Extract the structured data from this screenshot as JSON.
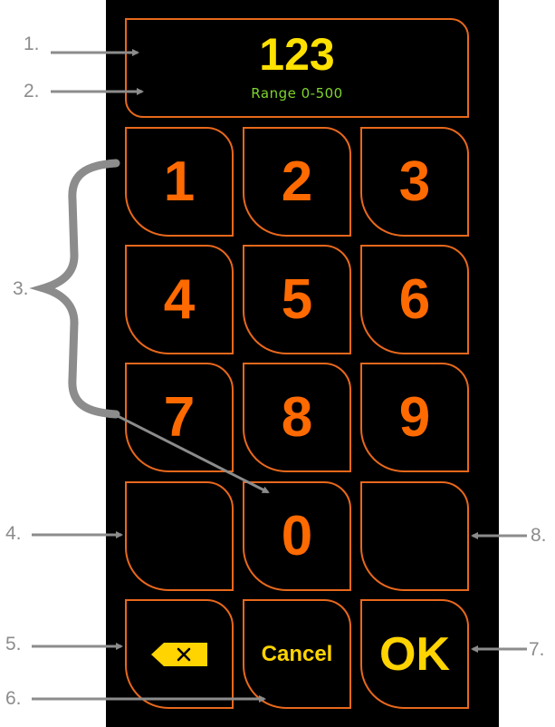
{
  "display": {
    "value": "123",
    "range": "Range 0-500"
  },
  "keys": {
    "k1": "1",
    "k2": "2",
    "k3": "3",
    "k4": "4",
    "k5": "5",
    "k6": "6",
    "k7": "7",
    "k8": "8",
    "k9": "9",
    "k0": "0",
    "cancel": "Cancel",
    "ok": "OK"
  },
  "icons": {
    "backspace": "backspace-icon"
  },
  "callouts": [
    "1.",
    "2.",
    "3.",
    "4.",
    "5.",
    "6.",
    "7.",
    "8."
  ],
  "colors": {
    "border": "#e8681c",
    "digit": "#ff6a00",
    "value": "#ffe100",
    "range": "#7fd42c",
    "action": "#ffd400",
    "callout": "#8c8c8c"
  }
}
